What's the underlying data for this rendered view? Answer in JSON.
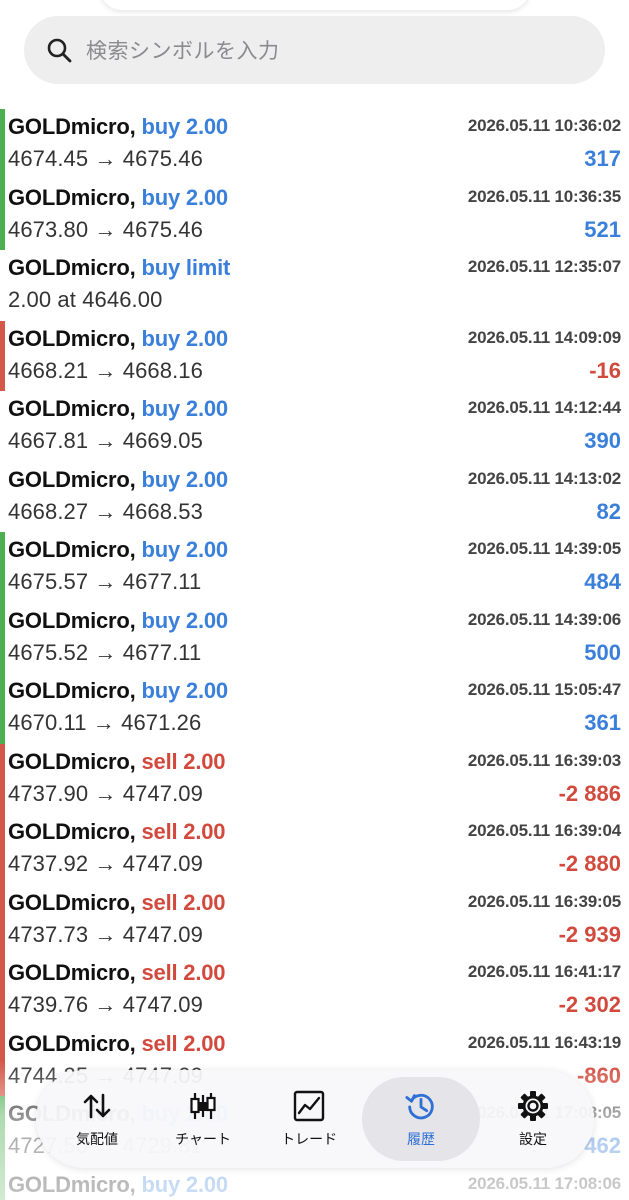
{
  "search": {
    "placeholder": "検索シンボルを入力"
  },
  "trades": [
    {
      "symbol": "GOLDmicro,",
      "action": "buy 2.00",
      "side": "buy",
      "time": "2026.05.11 10:36:02",
      "prices": "4674.45 → 4675.46",
      "profit": "317",
      "profit_sign": "pos",
      "marker": "green"
    },
    {
      "symbol": "GOLDmicro,",
      "action": "buy 2.00",
      "side": "buy",
      "time": "2026.05.11 10:36:35",
      "prices": "4673.80 → 4675.46",
      "profit": "521",
      "profit_sign": "pos",
      "marker": "green"
    },
    {
      "symbol": "GOLDmicro,",
      "action": "buy limit",
      "side": "buy",
      "time": "2026.05.11 12:35:07",
      "prices": "2.00 at 4646.00",
      "profit": "",
      "profit_sign": "pos",
      "marker": "none"
    },
    {
      "symbol": "GOLDmicro,",
      "action": "buy 2.00",
      "side": "buy",
      "time": "2026.05.11 14:09:09",
      "prices": "4668.21 → 4668.16",
      "profit": "-16",
      "profit_sign": "neg",
      "marker": "red"
    },
    {
      "symbol": "GOLDmicro,",
      "action": "buy 2.00",
      "side": "buy",
      "time": "2026.05.11 14:12:44",
      "prices": "4667.81 → 4669.05",
      "profit": "390",
      "profit_sign": "pos",
      "marker": "none"
    },
    {
      "symbol": "GOLDmicro,",
      "action": "buy 2.00",
      "side": "buy",
      "time": "2026.05.11 14:13:02",
      "prices": "4668.27 → 4668.53",
      "profit": "82",
      "profit_sign": "pos",
      "marker": "none"
    },
    {
      "symbol": "GOLDmicro,",
      "action": "buy 2.00",
      "side": "buy",
      "time": "2026.05.11 14:39:05",
      "prices": "4675.57 → 4677.11",
      "profit": "484",
      "profit_sign": "pos",
      "marker": "green"
    },
    {
      "symbol": "GOLDmicro,",
      "action": "buy 2.00",
      "side": "buy",
      "time": "2026.05.11 14:39:06",
      "prices": "4675.52 → 4677.11",
      "profit": "500",
      "profit_sign": "pos",
      "marker": "green"
    },
    {
      "symbol": "GOLDmicro,",
      "action": "buy 2.00",
      "side": "buy",
      "time": "2026.05.11 15:05:47",
      "prices": "4670.11 → 4671.26",
      "profit": "361",
      "profit_sign": "pos",
      "marker": "green"
    },
    {
      "symbol": "GOLDmicro,",
      "action": "sell 2.00",
      "side": "sell",
      "time": "2026.05.11 16:39:03",
      "prices": "4737.90 → 4747.09",
      "profit": "-2 886",
      "profit_sign": "neg",
      "marker": "red"
    },
    {
      "symbol": "GOLDmicro,",
      "action": "sell 2.00",
      "side": "sell",
      "time": "2026.05.11 16:39:04",
      "prices": "4737.92 → 4747.09",
      "profit": "-2 880",
      "profit_sign": "neg",
      "marker": "red"
    },
    {
      "symbol": "GOLDmicro,",
      "action": "sell 2.00",
      "side": "sell",
      "time": "2026.05.11 16:39:05",
      "prices": "4737.73 → 4747.09",
      "profit": "-2 939",
      "profit_sign": "neg",
      "marker": "red"
    },
    {
      "symbol": "GOLDmicro,",
      "action": "sell 2.00",
      "side": "sell",
      "time": "2026.05.11 16:41:17",
      "prices": "4739.76 → 4747.09",
      "profit": "-2 302",
      "profit_sign": "neg",
      "marker": "red"
    },
    {
      "symbol": "GOLDmicro,",
      "action": "sell 2.00",
      "side": "sell",
      "time": "2026.05.11 16:43:19",
      "prices": "4744.25 → 4747.09",
      "profit": "-860",
      "profit_sign": "neg",
      "marker": "red"
    },
    {
      "symbol": "GOLDmicro,",
      "action": "buy 2.00",
      "side": "buy",
      "time": "2026.05.11 17:08:05",
      "prices": "4727.50 → 4729.81",
      "profit": "462",
      "profit_sign": "pos",
      "marker": "green"
    },
    {
      "symbol": "GOLDmicro,",
      "action": "buy 2.00",
      "side": "buy",
      "time": "2026.05.11 17:08:06",
      "prices": "",
      "profit": "",
      "profit_sign": "pos",
      "marker": "green"
    }
  ],
  "tabs": [
    {
      "label": "気配値",
      "icon": "quotes-icon",
      "active": false
    },
    {
      "label": "チャート",
      "icon": "chart-icon",
      "active": false
    },
    {
      "label": "トレード",
      "icon": "trade-icon",
      "active": false
    },
    {
      "label": "履歴",
      "icon": "history-icon",
      "active": true
    },
    {
      "label": "設定",
      "icon": "settings-icon",
      "active": false
    }
  ],
  "colors": {
    "buy": "#3a80db",
    "sell": "#d24a3d",
    "profit_marker": "#4cae4f",
    "loss_marker": "#d3584a",
    "active_tab": "#2f6fd6"
  }
}
